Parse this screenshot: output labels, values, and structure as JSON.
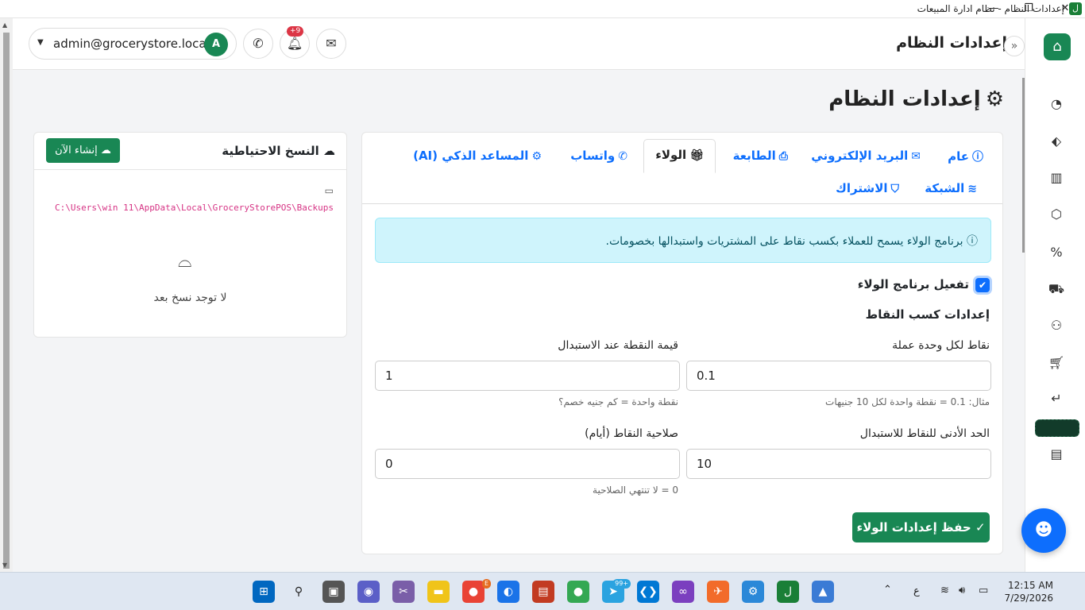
{
  "window": {
    "title": "إعدادات النظام - نظام ادارة المبيعات",
    "app_icon": "ل",
    "minimize_icon": "minimize-icon",
    "restore_icon": "restore-icon",
    "close_icon": "close-icon"
  },
  "header": {
    "title": "إعدادات النظام",
    "user_email": "admin@grocerystore.local",
    "avatar_letter": "A",
    "notification_count": "+9"
  },
  "page": {
    "title": "إعدادات النظام"
  },
  "tabs": [
    {
      "label": "عام",
      "icon": "info-icon",
      "active": false
    },
    {
      "label": "البريد الإلكتروني",
      "icon": "envelope-icon",
      "active": false
    },
    {
      "label": "الطابعة",
      "icon": "printer-icon",
      "active": false
    },
    {
      "label": "الولاء",
      "icon": "gift-icon",
      "active": true
    },
    {
      "label": "واتساب",
      "icon": "whatsapp-icon",
      "active": false
    },
    {
      "label": "المساعد الذكي (AI)",
      "icon": "robot-icon",
      "active": false
    },
    {
      "label": "الشبكة",
      "icon": "wifi-icon",
      "active": false
    },
    {
      "label": "الاشتراك",
      "icon": "shield-icon",
      "active": false
    }
  ],
  "loyalty": {
    "info": "برنامج الولاء يسمح للعملاء بكسب نقاط على المشتريات واستبدالها بخصومات.",
    "enable_label": "تفعيل برنامج الولاء",
    "enabled": true,
    "section_title": "إعدادات كسب النقاط",
    "points_per_unit_label": "نقاط لكل وحدة عملة",
    "points_per_unit_value": "0.1",
    "points_per_unit_help": "مثال: 0.1 = نقطة واحدة لكل 10 جنيهات",
    "point_value_label": "قيمة النقطة عند الاستبدال",
    "point_value_value": "1",
    "point_value_help": "نقطة واحدة = كم جنيه خصم؟",
    "min_points_label": "الحد الأدنى للنقاط للاستبدال",
    "min_points_value": "10",
    "expiry_label": "صلاحية النقاط (أيام)",
    "expiry_value": "0",
    "expiry_help": "0 = لا تنتهي الصلاحية",
    "save_label": "حفظ إعدادات الولاء"
  },
  "backup": {
    "title": "النسخ الاحتياطية",
    "create_label": "إنشاء الآن",
    "path": "C:\\Users\\win 11\\AppData\\Local\\GroceryStorePOS\\Backups",
    "empty_text": "لا توجد نسخ بعد"
  },
  "sidebar": {
    "items": [
      "dashboard-icon",
      "tags-icon",
      "barcode-icon",
      "box-icon",
      "percent-icon",
      "truck-icon",
      "users-icon",
      "cart-icon",
      "return-icon",
      "active-item",
      "receipt-icon"
    ]
  },
  "taskbar": {
    "time": "12:15 AM",
    "date": "7/29/2026",
    "lang": "ع",
    "telegram_badge": "99+",
    "chrome_badge": "E"
  },
  "colors": {
    "primary": "#0d6efd",
    "success": "#198754",
    "info_bg": "#cff4fc"
  }
}
